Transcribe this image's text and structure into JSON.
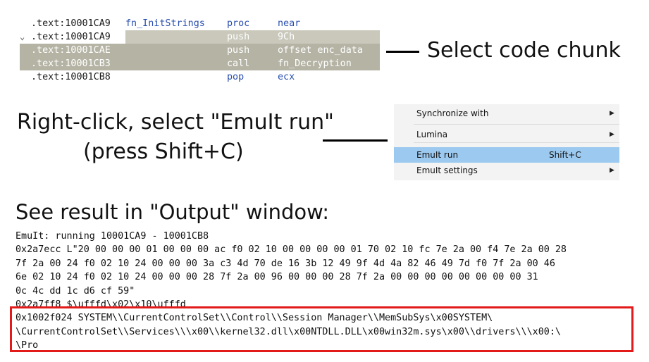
{
  "code": {
    "rows": [
      {
        "addr": ".text:10001CA9",
        "name": "fn_InitStrings",
        "mnemonic": "proc",
        "operand": "near",
        "chevron": "",
        "selected": false
      },
      {
        "addr": ".text:10001CA9",
        "name": "",
        "mnemonic": "push",
        "operand": "9Ch",
        "chevron": "⌄",
        "selected": true
      },
      {
        "addr": ".text:10001CAE",
        "name": "",
        "mnemonic": "push",
        "operand": "offset enc_data",
        "chevron": "",
        "selected": true
      },
      {
        "addr": ".text:10001CB3",
        "name": "",
        "mnemonic": "call",
        "operand": "fn_Decryption",
        "chevron": "",
        "selected": true
      },
      {
        "addr": ".text:10001CB8",
        "name": "",
        "mnemonic": "pop",
        "operand": "ecx",
        "chevron": "",
        "selected": false
      }
    ]
  },
  "callouts": {
    "select": "Select code chunk",
    "right_click_line1": "Right-click, select \"EmuIt run\"",
    "right_click_line2": "(press Shift+C)",
    "result": "See result in \"Output\" window:"
  },
  "menu": {
    "items": [
      {
        "label": "Synchronize with",
        "shortcut": "",
        "submenu": true,
        "highlighted": false
      },
      {
        "label": "Lumina",
        "shortcut": "",
        "submenu": true,
        "highlighted": false
      },
      {
        "label": "EmuIt run",
        "shortcut": "Shift+C",
        "submenu": false,
        "highlighted": true
      },
      {
        "label": "EmuIt settings",
        "shortcut": "",
        "submenu": true,
        "highlighted": false
      }
    ]
  },
  "output": {
    "lines": [
      "EmuIt: running 10001CA9 - 10001CB8",
      "0x2a7ecc L\"20 00 00 00 01 00 00 00 ac f0 02 10 00 00 00 00 01 70 02 10 fc 7e 2a 00 f4 7e 2a 00 28",
      "7f 2a 00 24 f0 02 10 24 00 00 00 3a c3 4d 70 de 16 3b 12 49 9f 4d 4a 82 46 49 7d f0 7f 2a 00 46",
      "6e 02 10 24 f0 02 10 24 00 00 00 28 7f 2a 00 96 00 00 00 28 7f 2a 00 00 00 00 00 00 00 00 31",
      "0c 4c dd 1c d6 cf 59\"",
      "0x2a7ff8 $\\ufffd\\x02\\x10\\ufffd",
      "0x1002f024 SYSTEM\\\\CurrentControlSet\\\\Control\\\\Session Manager\\\\MemSubSys\\x00SYSTEM\\",
      "\\CurrentControlSet\\\\Services\\\\\\x00\\\\kernel32.dll\\x00NTDLL.DLL\\x00win32m.sys\\x00\\\\drivers\\\\\\x00:\\",
      "\\Pro"
    ]
  }
}
